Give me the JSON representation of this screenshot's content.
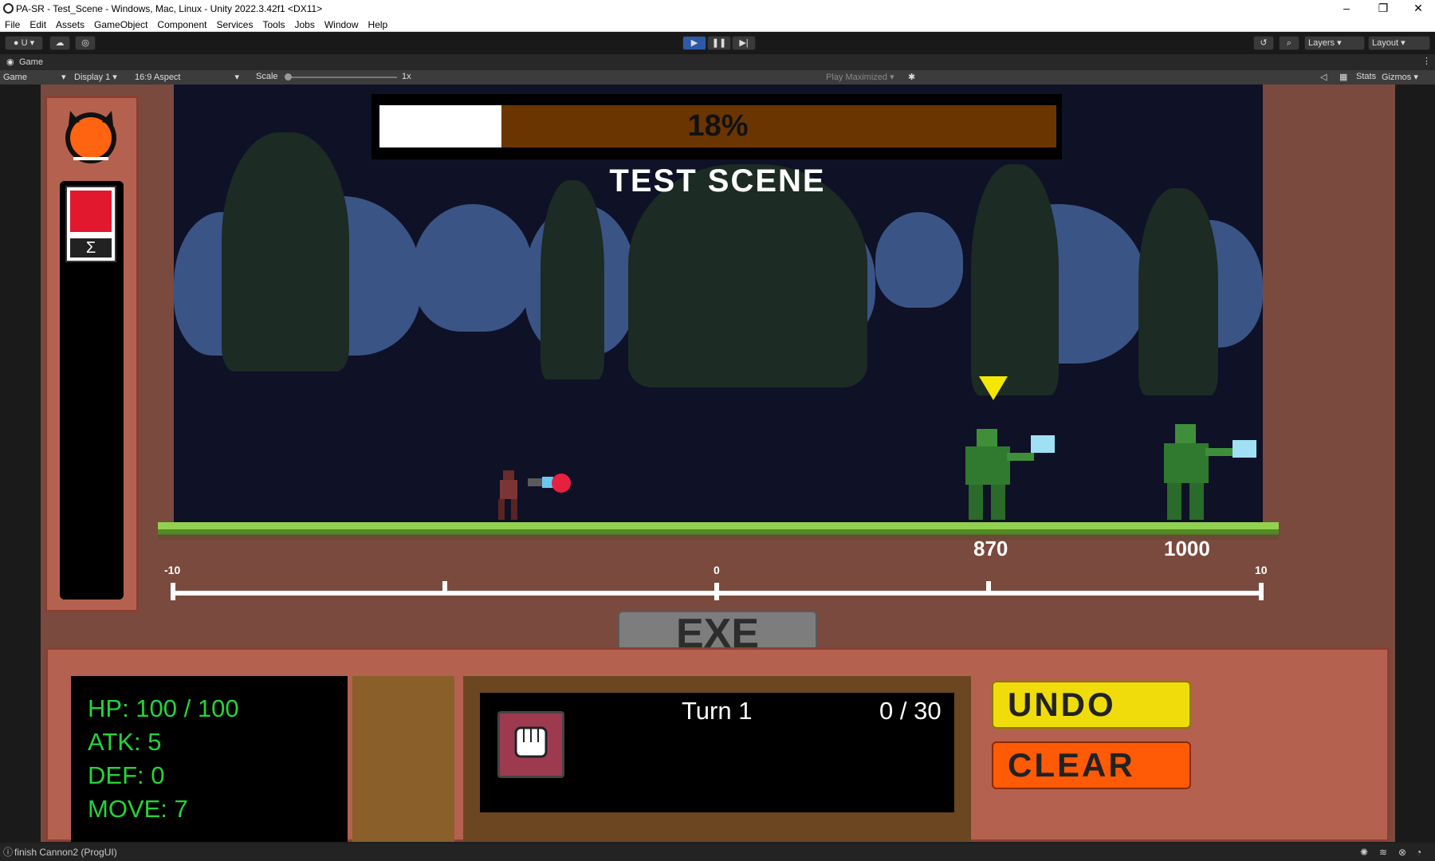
{
  "window": {
    "title": "PA-SR - Test_Scene - Windows, Mac, Linux - Unity 2022.3.42f1 <DX11>"
  },
  "menu": [
    "File",
    "Edit",
    "Assets",
    "GameObject",
    "Component",
    "Services",
    "Tools",
    "Jobs",
    "Window",
    "Help"
  ],
  "toolbar": {
    "account": "U",
    "layers": "Layers",
    "layout": "Layout"
  },
  "game_tab": {
    "label": "Game"
  },
  "game_bar": {
    "mode": "Game",
    "display": "Display 1",
    "aspect": "16:9 Aspect",
    "scale_label": "Scale",
    "scale_value": "1x",
    "play_maximized": "Play Maximized",
    "stats": "Stats",
    "gizmos": "Gizmos"
  },
  "game": {
    "progress_text": "18%",
    "progress_value": 0.18,
    "scene_title": "TEST SCENE",
    "enemy_positions": [
      "870",
      "1000"
    ],
    "timeline_labels": [
      "-10",
      "0",
      "10"
    ],
    "exe_label": "EXE",
    "sigma": "Σ",
    "stats": [
      "HP: 100 / 100",
      "ATK: 5",
      "DEF: 0",
      "MOVE: 7"
    ],
    "turn": "Turn 1",
    "turn_count": "0 / 30",
    "undo": "UNDO",
    "clear": "CLEAR"
  },
  "status": {
    "message": "finish Cannon2 (ProgUI)"
  }
}
